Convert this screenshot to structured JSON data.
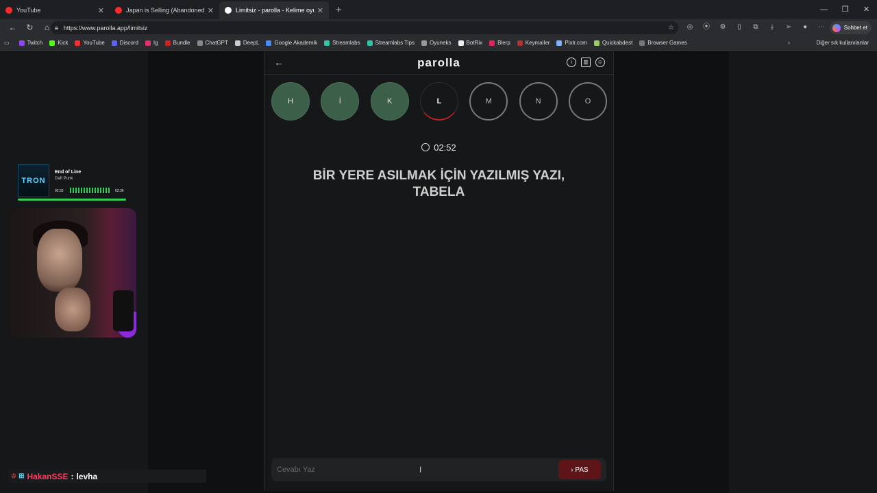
{
  "browser": {
    "tabs": [
      {
        "title": "YouTube",
        "color": "#ff2b2b"
      },
      {
        "title": "Japan is Selling (Abandoned) Hou",
        "color": "#ff2b2b"
      },
      {
        "title": "Limitsiz - parolla - Kelime oyunu",
        "color": "#ffffff"
      }
    ],
    "url": "https://www.parolla.app/limitsiz",
    "copilot_label": "Sohbet et",
    "bookmarks": [
      "Twitch",
      "Kick",
      "YouTube",
      "Discord",
      "Ig",
      "Bundle",
      "ChatGPT",
      "DeepL",
      "Google Akademik",
      "Streamlabs",
      "Streamlabs Tips",
      "Oyuneks",
      "BotRix",
      "Blerp",
      "Keymailer",
      "Pixlr.com",
      "Quickabdest",
      "Browser Games"
    ],
    "other_bookmarks": "Diğer sık kullanılanlar"
  },
  "music": {
    "cover": "TRON",
    "song": "End of Line",
    "artist": "Daft Punk",
    "elapsed": "02:33",
    "total": "02:36"
  },
  "chat": {
    "user": "HakanSSE",
    "message": "levha"
  },
  "app": {
    "logo": "parolla",
    "letters": [
      {
        "char": "H",
        "state": "done"
      },
      {
        "char": "İ",
        "state": "done"
      },
      {
        "char": "K",
        "state": "done"
      },
      {
        "char": "L",
        "state": "current"
      },
      {
        "char": "M",
        "state": "todo"
      },
      {
        "char": "N",
        "state": "todo"
      },
      {
        "char": "O",
        "state": "todo"
      }
    ],
    "timer": "02:52",
    "question": "BİR YERE ASILMAK İÇİN YAZILMIŞ YAZI, TABELA",
    "answer_placeholder": "Cevabı Yaz",
    "pass_label": "PAS"
  }
}
